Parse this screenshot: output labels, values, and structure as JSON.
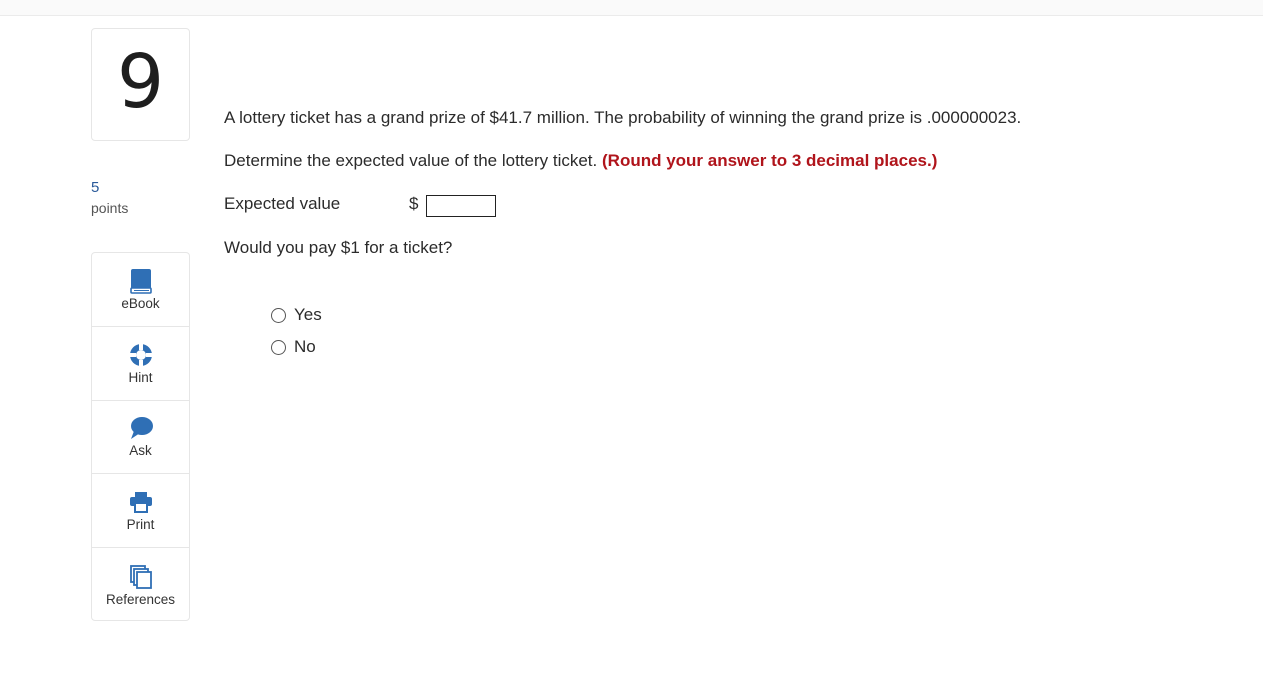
{
  "question": {
    "number": "9",
    "points_value": "5",
    "points_label": "points"
  },
  "tools": [
    {
      "label": "eBook",
      "icon": "book-icon"
    },
    {
      "label": "Hint",
      "icon": "lifebuoy-icon"
    },
    {
      "label": "Ask",
      "icon": "speech-bubble-icon"
    },
    {
      "label": "Print",
      "icon": "printer-icon"
    },
    {
      "label": "References",
      "icon": "documents-icon"
    }
  ],
  "body": {
    "prompt": "A lottery ticket has a grand prize of $41.7 million. The probability of winning the grand prize is .000000023.",
    "instruction": "Determine the expected value of the lottery ticket.",
    "instruction_emphasis": "(Round your answer to 3 decimal places.)",
    "expected_value_label": "Expected value",
    "currency_symbol": "$",
    "expected_value_input": "",
    "followup": "Would you pay $1 for a ticket?",
    "options": [
      "Yes",
      "No"
    ]
  },
  "colors": {
    "accent_blue": "#2f6fb5",
    "emphasis_red": "#b0141b"
  }
}
